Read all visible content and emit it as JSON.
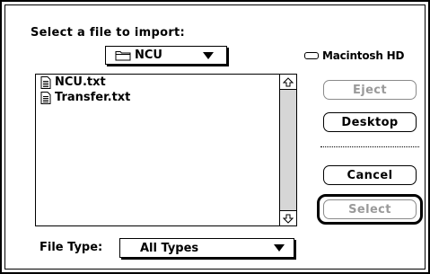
{
  "dialog": {
    "prompt": "Select a file to import:",
    "folder_popup": {
      "icon": "folder-icon",
      "value": "NCU"
    },
    "disk": {
      "icon": "hard-disk-icon",
      "label": "Macintosh HD"
    },
    "files": [
      {
        "icon": "document-icon",
        "name": "NCU.txt"
      },
      {
        "icon": "document-icon",
        "name": "Transfer.txt"
      }
    ],
    "buttons": {
      "eject": "Eject",
      "desktop": "Desktop",
      "cancel": "Cancel",
      "select": "Select"
    },
    "file_type": {
      "label": "File Type:",
      "value": "All Types"
    }
  }
}
